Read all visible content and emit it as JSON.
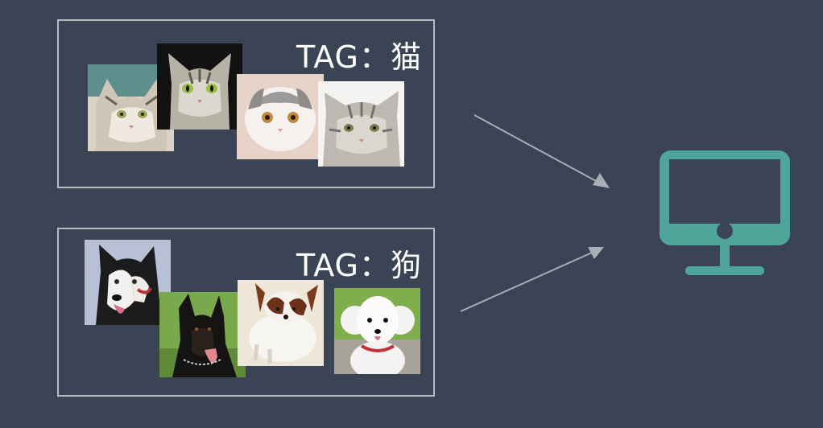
{
  "groups": [
    {
      "tag": "TAG：猫",
      "photos": [
        "cat-photo-1",
        "cat-photo-2",
        "cat-photo-3",
        "cat-photo-4"
      ]
    },
    {
      "tag": "TAG：狗",
      "photos": [
        "husky-photo",
        "doberman-photo",
        "papillon-photo",
        "poodle-photo"
      ]
    }
  ],
  "icons": {
    "computer": "monitor-icon",
    "arrow": "arrow-icon"
  },
  "colors": {
    "background": "#3b4455",
    "border": "#b7bcc4",
    "accent": "#4fa59a",
    "arrow": "#a9adb4",
    "text": "#ffffff"
  }
}
